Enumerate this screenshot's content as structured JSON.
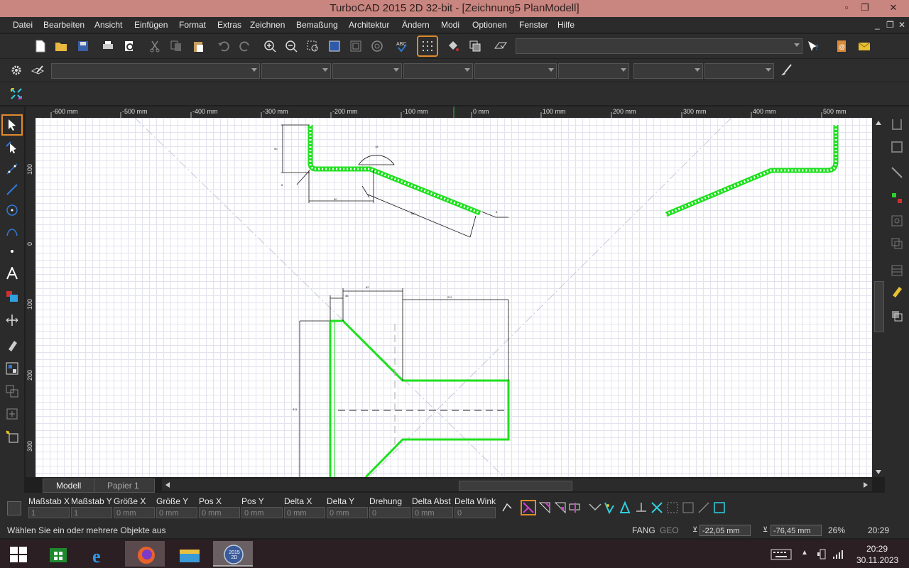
{
  "title": "TurboCAD 2015 2D 32-bit - [Zeichnung5 PlanModell]",
  "window_controls": {
    "minimize": "▫",
    "restore": "❐",
    "close": "✕"
  },
  "menu": [
    "Datei",
    "Bearbeiten",
    "Ansicht",
    "Einfügen",
    "Format",
    "Extras",
    "Zeichnen",
    "Bemaßung",
    "Architektur",
    "Ändern",
    "Modi",
    "Optionen",
    "Fenster",
    "Hilfe"
  ],
  "mdi_controls": {
    "minimize": "_",
    "restore": "❐",
    "close": "✕"
  },
  "ruler_h": [
    "-600 mm",
    "-500 mm",
    "-400 mm",
    "-300 mm",
    "-200 mm",
    "-100 mm",
    "0 mm",
    "100 mm",
    "200 mm",
    "300 mm",
    "400 mm",
    "500 mm"
  ],
  "ruler_v": [
    "100 mm",
    "0 mm",
    "100 mm",
    "200 mm",
    "300 mm"
  ],
  "tabs": {
    "model": "Modell",
    "paper": "Papier 1"
  },
  "fields": [
    {
      "label": "Maßstab X",
      "value": "1"
    },
    {
      "label": "Maßstab Y",
      "value": "1"
    },
    {
      "label": "Größe X",
      "value": "0 mm"
    },
    {
      "label": "Größe Y",
      "value": "0 mm"
    },
    {
      "label": "Pos X",
      "value": "0 mm"
    },
    {
      "label": "Pos Y",
      "value": "0 mm"
    },
    {
      "label": "Delta X",
      "value": "0 mm"
    },
    {
      "label": "Delta Y",
      "value": "0 mm"
    },
    {
      "label": "Drehung",
      "value": "0"
    },
    {
      "label": "Delta Abst",
      "value": "0 mm"
    },
    {
      "label": "Delta Wink",
      "value": "0"
    }
  ],
  "status": {
    "message": "Wählen Sie ein oder mehrere Objekte aus",
    "fang": "FANG",
    "geo": "GEO",
    "x": "-22,05 mm",
    "y": "-76,45 mm",
    "zoom": "26%",
    "time": "20:29"
  },
  "taskbar": {
    "time": "20:29",
    "date": "30.11.2023",
    "app_badge": "2015 2D"
  },
  "colors": {
    "title_bar": "#c9857f",
    "geometry": "#1ee01e",
    "active_outline": "#e08a2c"
  }
}
